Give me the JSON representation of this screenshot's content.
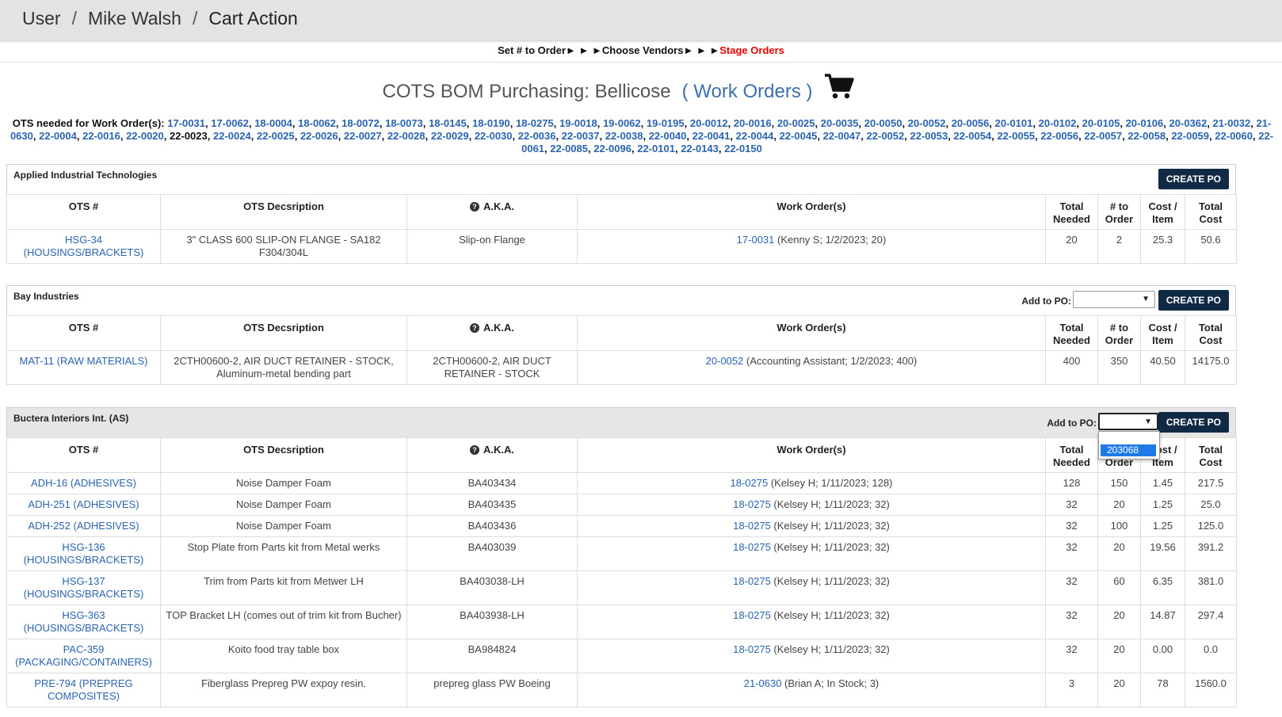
{
  "breadcrumb": [
    "User",
    "Mike Walsh",
    "Cart Action"
  ],
  "breadcrumb_sep": "/",
  "steps": {
    "step1": "Set # to Order",
    "arrows": "► ► ►",
    "step2": "Choose Vendors",
    "arrows2": "► ► ►",
    "step3": "Stage Orders"
  },
  "title": {
    "text": "COTS BOM Purchasing: Bellicose",
    "link": "( Work Orders )"
  },
  "work_orders": {
    "label": "OTS needed for Work Order(s):",
    "items": [
      "17-0031",
      "17-0062",
      "18-0004",
      "18-0062",
      "18-0072",
      "18-0073",
      "18-0145",
      "18-0190",
      "18-0275",
      "19-0018",
      "19-0062",
      "19-0195",
      "20-0012",
      "20-0016",
      "20-0025",
      "20-0035",
      "20-0050",
      "20-0052",
      "20-0056",
      "20-0101",
      "20-0102",
      "20-0105",
      "20-0106",
      "20-0362",
      "21-0032",
      "21-0630",
      "22-0004",
      "22-0016",
      "22-0020",
      "22-0023",
      "22-0024",
      "22-0025",
      "22-0026",
      "22-0027",
      "22-0028",
      "22-0029",
      "22-0030",
      "22-0036",
      "22-0037",
      "22-0038",
      "22-0040",
      "22-0041",
      "22-0044",
      "22-0045",
      "22-0047",
      "22-0052",
      "22-0053",
      "22-0054",
      "22-0055",
      "22-0056",
      "22-0057",
      "22-0058",
      "22-0059",
      "22-0060",
      "22-0061",
      "22-0085",
      "22-0096",
      "22-0101",
      "22-0143",
      "22-0150"
    ],
    "plain_item": "22-0023"
  },
  "columns": [
    "OTS #",
    "OTS Decsription",
    "A.K.A.",
    "Work Order(s)",
    "Total Needed",
    "# to Order",
    "Cost / Item",
    "Total Cost"
  ],
  "create_po_label": "CREATE PO",
  "add_to_po_label": "Add to PO:",
  "dropdown_option": "203068",
  "vendors": [
    {
      "name": "Applied Industrial Technologies",
      "rows": [
        {
          "ots": "HSG-34 (HOUSINGS/BRACKETS)",
          "desc": "3\" CLASS 600 SLIP-ON FLANGE - SA182 F304/304L",
          "aka": "Slip-on Flange",
          "wo_link": "17-0031",
          "wo_text": " (Kenny S; 1/2/2023; 20)",
          "needed": "20",
          "order": "2",
          "cost": "25.3",
          "total": "50.6"
        }
      ]
    },
    {
      "name": "Bay Industries",
      "rows": [
        {
          "ots": "MAT-11 (RAW MATERIALS)",
          "desc": "2CTH00600-2, AIR DUCT RETAINER - STOCK, Aluminum-metal bending part",
          "aka": "2CTH00600-2, AIR DUCT RETAINER - STOCK",
          "wo_link": "20-0052",
          "wo_text": " (Accounting Assistant; 1/2/2023; 400)",
          "needed": "400",
          "order": "350",
          "cost": "40.50",
          "total": "14175.0"
        }
      ]
    },
    {
      "name": "Buctera Interiors Int. (AS)",
      "rows": [
        {
          "ots": "ADH-16 (ADHESIVES)",
          "desc": "Noise Damper Foam",
          "aka": "BA403434",
          "wo_link": "18-0275",
          "wo_text": " (Kelsey H; 1/11/2023; 128)",
          "needed": "128",
          "order": "150",
          "cost": "1.45",
          "total": "217.5"
        },
        {
          "ots": "ADH-251 (ADHESIVES)",
          "desc": "Noise Damper Foam",
          "aka": "BA403435",
          "wo_link": "18-0275",
          "wo_text": " (Kelsey H; 1/11/2023; 32)",
          "needed": "32",
          "order": "20",
          "cost": "1.25",
          "total": "25.0"
        },
        {
          "ots": "ADH-252 (ADHESIVES)",
          "desc": "Noise Damper Foam",
          "aka": "BA403436",
          "wo_link": "18-0275",
          "wo_text": " (Kelsey H; 1/11/2023; 32)",
          "needed": "32",
          "order": "100",
          "cost": "1.25",
          "total": "125.0"
        },
        {
          "ots": "HSG-136 (HOUSINGS/BRACKETS)",
          "desc": "Stop Plate from Parts kit from Metal werks",
          "aka": "BA403039",
          "wo_link": "18-0275",
          "wo_text": " (Kelsey H; 1/11/2023; 32)",
          "needed": "32",
          "order": "20",
          "cost": "19.56",
          "total": "391.2"
        },
        {
          "ots": "HSG-137 (HOUSINGS/BRACKETS)",
          "desc": "Trim from Parts kit from Metwer LH",
          "aka": "BA403038-LH",
          "wo_link": "18-0275",
          "wo_text": " (Kelsey H; 1/11/2023; 32)",
          "needed": "32",
          "order": "60",
          "cost": "6.35",
          "total": "381.0"
        },
        {
          "ots": "HSG-363 (HOUSINGS/BRACKETS)",
          "desc": "TOP Bracket LH (comes out of trim kit from Bucher)",
          "aka": "BA403938-LH",
          "wo_link": "18-0275",
          "wo_text": " (Kelsey H; 1/11/2023; 32)",
          "needed": "32",
          "order": "20",
          "cost": "14.87",
          "total": "297.4"
        },
        {
          "ots": "PAC-359 (PACKAGING/CONTAINERS)",
          "desc": "Koito food tray table box",
          "aka": "BA984824",
          "wo_link": "18-0275",
          "wo_text": " (Kelsey H; 1/11/2023; 32)",
          "needed": "32",
          "order": "20",
          "cost": "0.00",
          "total": "0.0"
        },
        {
          "ots": "PRE-794 (PREPREG COMPOSITES)",
          "desc": "Fiberglass Prepreg PW expoy resin.",
          "aka": "prepreg glass PW Boeing",
          "wo_link": "21-0630",
          "wo_text": " (Brian A; In Stock; 3)",
          "needed": "3",
          "order": "20",
          "cost": "78",
          "total": "1560.0"
        }
      ]
    }
  ]
}
